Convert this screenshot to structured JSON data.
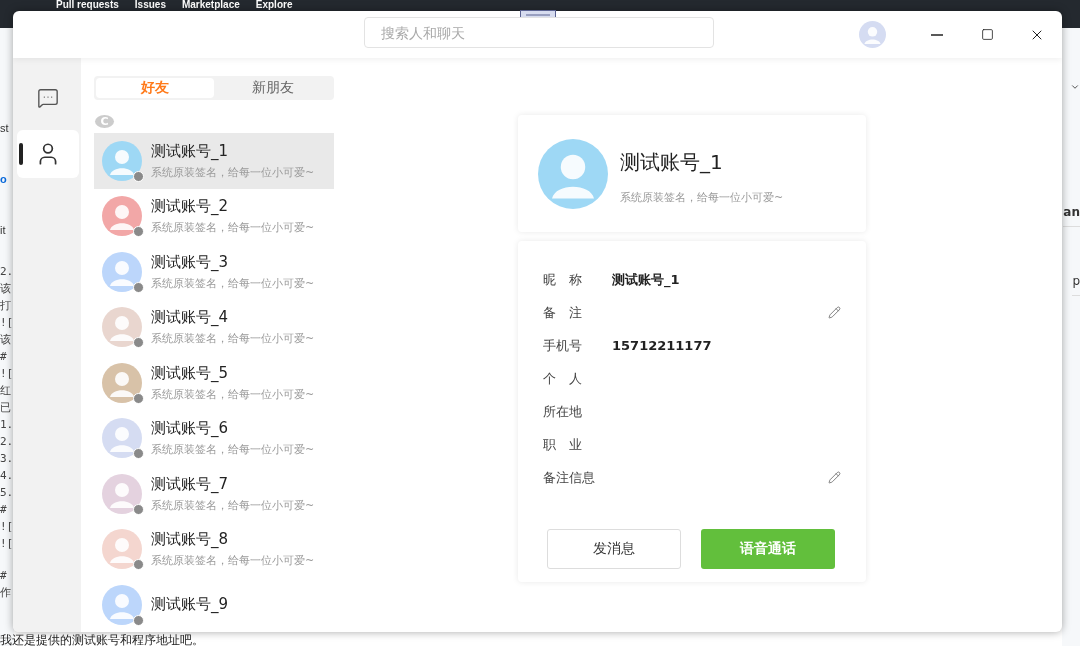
{
  "backdrop": {
    "nav_links": [
      "Pull requests",
      "Issues",
      "Marketplace",
      "Explore"
    ],
    "left_fragments": [
      {
        "text": "st",
        "kind": "ui"
      },
      {
        "text": "o",
        "kind": "link"
      },
      {
        "text": "it",
        "kind": "ui"
      },
      {
        "text": "2.",
        "kind": "code"
      },
      {
        "text": "该",
        "kind": "code"
      },
      {
        "text": "打",
        "kind": "code"
      },
      {
        "text": "![",
        "kind": "code"
      },
      {
        "text": "该",
        "kind": "code"
      },
      {
        "text": "#",
        "kind": "code"
      },
      {
        "text": "![",
        "kind": "code"
      },
      {
        "text": "红",
        "kind": "code"
      },
      {
        "text": "已",
        "kind": "code"
      },
      {
        "text": "1.",
        "kind": "code"
      },
      {
        "text": "2.",
        "kind": "code"
      },
      {
        "text": "3.",
        "kind": "code"
      },
      {
        "text": "4.",
        "kind": "code"
      },
      {
        "text": "5.",
        "kind": "code"
      },
      {
        "text": "#",
        "kind": "code"
      },
      {
        "text": "![",
        "kind": "code"
      },
      {
        "text": "![",
        "kind": "code"
      },
      {
        "text": "#",
        "kind": "gap"
      },
      {
        "text": "作",
        "kind": "code"
      }
    ],
    "bottom_line": "我还是提供的测试账号和程序地址吧。",
    "right_fragments": [
      "an",
      "p"
    ]
  },
  "window": {
    "search": {
      "placeholder": "搜索人和聊天"
    }
  },
  "nav": [
    {
      "kind": "chat",
      "selected": false
    },
    {
      "kind": "contacts",
      "selected": true
    }
  ],
  "tabs": [
    {
      "label": "好友",
      "selected": true
    },
    {
      "label": "新朋友",
      "selected": false
    }
  ],
  "group_letter": "C",
  "friends": [
    {
      "name": "测试账号_1",
      "signature": "系统原装签名，给每一位小可爱~",
      "color": "#9ed8f5",
      "online": false,
      "selected": true
    },
    {
      "name": "测试账号_2",
      "signature": "系统原装签名，给每一位小可爱~",
      "color": "#f2a7a7",
      "online": false,
      "selected": false
    },
    {
      "name": "测试账号_3",
      "signature": "系统原装签名，给每一位小可爱~",
      "color": "#bcd6fb",
      "online": false,
      "selected": false
    },
    {
      "name": "测试账号_4",
      "signature": "系统原装签名，给每一位小可爱~",
      "color": "#e9d6cf",
      "online": false,
      "selected": false
    },
    {
      "name": "测试账号_5",
      "signature": "系统原装签名，给每一位小可爱~",
      "color": "#d8c2a8",
      "online": false,
      "selected": false
    },
    {
      "name": "测试账号_6",
      "signature": "系统原装签名，给每一位小可爱~",
      "color": "#d5dcf2",
      "online": false,
      "selected": false
    },
    {
      "name": "测试账号_7",
      "signature": "系统原装签名，给每一位小可爱~",
      "color": "#e4d2df",
      "online": false,
      "selected": false
    },
    {
      "name": "测试账号_8",
      "signature": "系统原装签名，给每一位小可爱~",
      "color": "#f4d6cf",
      "online": false,
      "selected": false
    },
    {
      "name": "测试账号_9",
      "color": "#bcd6fb",
      "online": false,
      "selected": false
    }
  ],
  "profile": {
    "name": "测试账号_1",
    "signature": "系统原装签名，给每一位小可爱~",
    "color": "#9ed8f5"
  },
  "info": [
    {
      "label": "昵　称",
      "value": "测试账号_1",
      "editable": false
    },
    {
      "label": "备　注",
      "editable": true
    },
    {
      "label": "手机号",
      "value": "15712211177",
      "editable": false
    },
    {
      "label": "个　人",
      "editable": false
    },
    {
      "label": "所在地",
      "editable": false
    },
    {
      "label": "职　业",
      "editable": false
    },
    {
      "label": "备注信息",
      "editable": true
    }
  ],
  "buttons": [
    {
      "label": "发消息",
      "kind": "secondary"
    },
    {
      "label": "语音通话",
      "kind": "primary"
    }
  ]
}
